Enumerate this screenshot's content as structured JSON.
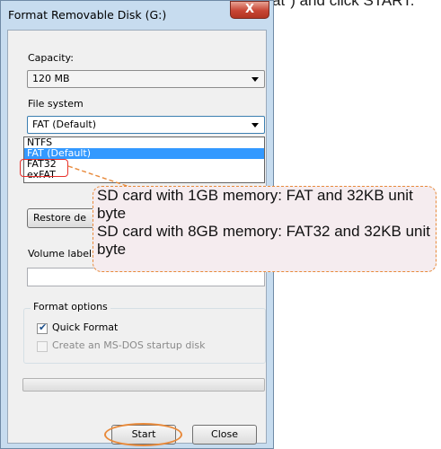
{
  "instruction_caption": "check \"Quick Format\") and click START.",
  "window": {
    "title": "Format Removable Disk (G:)",
    "close_label": "X"
  },
  "capacity": {
    "label": "Capacity:",
    "value": "120 MB"
  },
  "file_system": {
    "label": "File system",
    "value": "FAT (Default)",
    "options": [
      "NTFS",
      "FAT (Default)",
      "FAT32",
      "exFAT"
    ],
    "highlighted_option": "FAT (Default)"
  },
  "restore_button": {
    "label": "Restore de"
  },
  "volume_label": {
    "label": "Volume label",
    "value": ""
  },
  "format_options": {
    "group_label": "Format options",
    "quick_format": {
      "label": "Quick Format",
      "checked": true
    },
    "msdos": {
      "label": "Create an MS-DOS startup disk",
      "checked": false,
      "disabled": true
    }
  },
  "progress": {
    "value": 0
  },
  "buttons": {
    "start": "Start",
    "close": "Close"
  },
  "callout": {
    "line1": "SD card with 1GB memory: FAT and 32KB unit byte",
    "line2": "SD card with 8GB memory: FAT32 and 32KB unit byte"
  },
  "colors": {
    "callout_border": "#e88a3b",
    "highlight_box": "#e8312c",
    "selection": "#3399ff"
  }
}
